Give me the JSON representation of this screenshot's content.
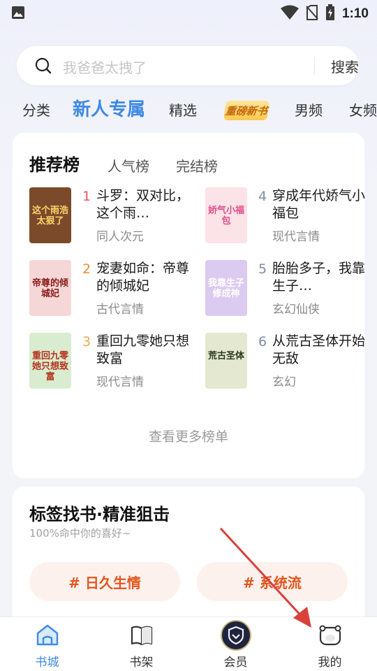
{
  "status_bar": {
    "time": "1:10",
    "icons": [
      "gallery-icon",
      "wifi-icon",
      "no-sim-icon",
      "battery-charging-icon"
    ]
  },
  "search": {
    "placeholder": "我爸爸太拽了",
    "button": "搜索",
    "icon": "search-icon"
  },
  "category_tabs": [
    {
      "label": "分类"
    },
    {
      "label": "新人专属",
      "active": true
    },
    {
      "label": "精选"
    },
    {
      "label": "重磅新书",
      "badge": true
    },
    {
      "label": "男频"
    },
    {
      "label": "女频"
    }
  ],
  "ranking": {
    "tabs": [
      {
        "label": "推荐榜",
        "active": true
      },
      {
        "label": "人气榜"
      },
      {
        "label": "完结榜"
      }
    ],
    "books": [
      {
        "rank": "1",
        "title": "斗罗：双对比，这个雨…",
        "category": "同人次元",
        "cover_text": "这个雨浩太狠了",
        "cover_bg": "#7a4a2a",
        "cover_fg": "#ffd36a",
        "rank_color": "#e55a5a"
      },
      {
        "rank": "2",
        "title": "宠妻如命：帝尊的倾城妃",
        "category": "古代言情",
        "cover_text": "帝尊的倾城妃",
        "cover_bg": "#f6d7d7",
        "cover_fg": "#8a1a1a",
        "rank_color": "#f08c2c"
      },
      {
        "rank": "3",
        "title": "重回九零她只想致富",
        "category": "现代言情",
        "cover_text": "重回九零她只想致富",
        "cover_bg": "#d9ecd0",
        "cover_fg": "#b5321c",
        "rank_color": "#f0a84a"
      },
      {
        "rank": "4",
        "title": "穿成年代娇气小福包",
        "category": "现代言情",
        "cover_text": "娇气小福包",
        "cover_bg": "#fbe3e8",
        "cover_fg": "#e2508a",
        "rank_color": "#7b8fa8"
      },
      {
        "rank": "5",
        "title": "胎胎多子，我靠生子…",
        "category": "玄幻仙侠",
        "cover_text": "我靠生子修成神",
        "cover_bg": "#dccbf0",
        "cover_fg": "#ffffff",
        "rank_color": "#7b8fa8"
      },
      {
        "rank": "6",
        "title": "从荒古圣体开始无敌",
        "category": "玄幻",
        "cover_text": "荒古圣体",
        "cover_bg": "#e4e8d0",
        "cover_fg": "#2a3a1a",
        "rank_color": "#7b8fa8"
      }
    ],
    "more_label": "查看更多榜单"
  },
  "tags_section": {
    "title": "标签找书·精准狙击",
    "subtitle": "100%命中你的喜好~",
    "tags": [
      "# 日久生情",
      "# 系统流"
    ]
  },
  "bottom_nav": [
    {
      "label": "书城",
      "icon": "home-icon",
      "active": true
    },
    {
      "label": "书架",
      "icon": "bookshelf-icon"
    },
    {
      "label": "会员",
      "icon": "vip-shield-icon"
    },
    {
      "label": "我的",
      "icon": "profile-icon"
    }
  ],
  "colors": {
    "accent": "#3e8ae3",
    "tag_text": "#e2561d",
    "tag_bg": "#fdf1ee",
    "arrow": "#d9413a"
  }
}
